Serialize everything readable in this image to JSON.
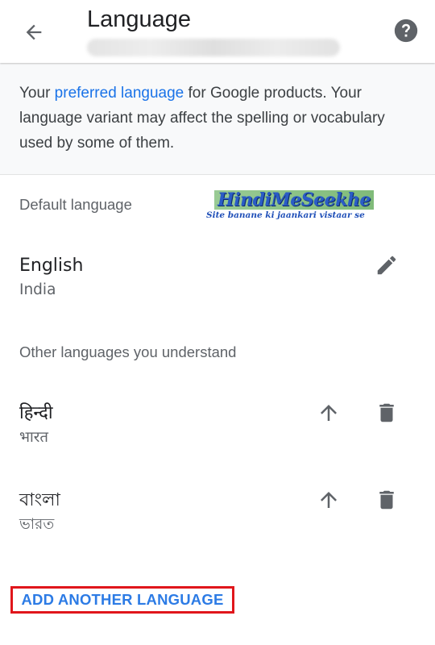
{
  "header": {
    "title": "Language",
    "subtitle": "",
    "back_icon": "arrow-back-icon",
    "help_icon": "help-icon"
  },
  "intro": {
    "text_before": "Your ",
    "link_text": "preferred language",
    "text_after": " for Google products. Your language variant may affect the spelling or vocabulary used by some of them."
  },
  "default_section": {
    "heading": "Default language",
    "language": {
      "name": "English",
      "region": "India",
      "edit_icon": "edit-pencil-icon"
    }
  },
  "watermark": {
    "title": "HindiMeSeekhe",
    "subtitle": "Site banane ki jaankari vistaar se"
  },
  "other_section": {
    "heading": "Other languages you understand",
    "languages": [
      {
        "name": "हिन्दी",
        "region": "भारत",
        "move_up_icon": "arrow-up-icon",
        "delete_icon": "trash-icon"
      },
      {
        "name": "বাংলা",
        "region": "ভারত",
        "move_up_icon": "arrow-up-icon",
        "delete_icon": "trash-icon"
      }
    ]
  },
  "add_button": {
    "label": "ADD ANOTHER LANGUAGE"
  },
  "colors": {
    "accent": "#1a73e8",
    "highlight_border": "#e0161b",
    "icon": "#5f6368"
  }
}
